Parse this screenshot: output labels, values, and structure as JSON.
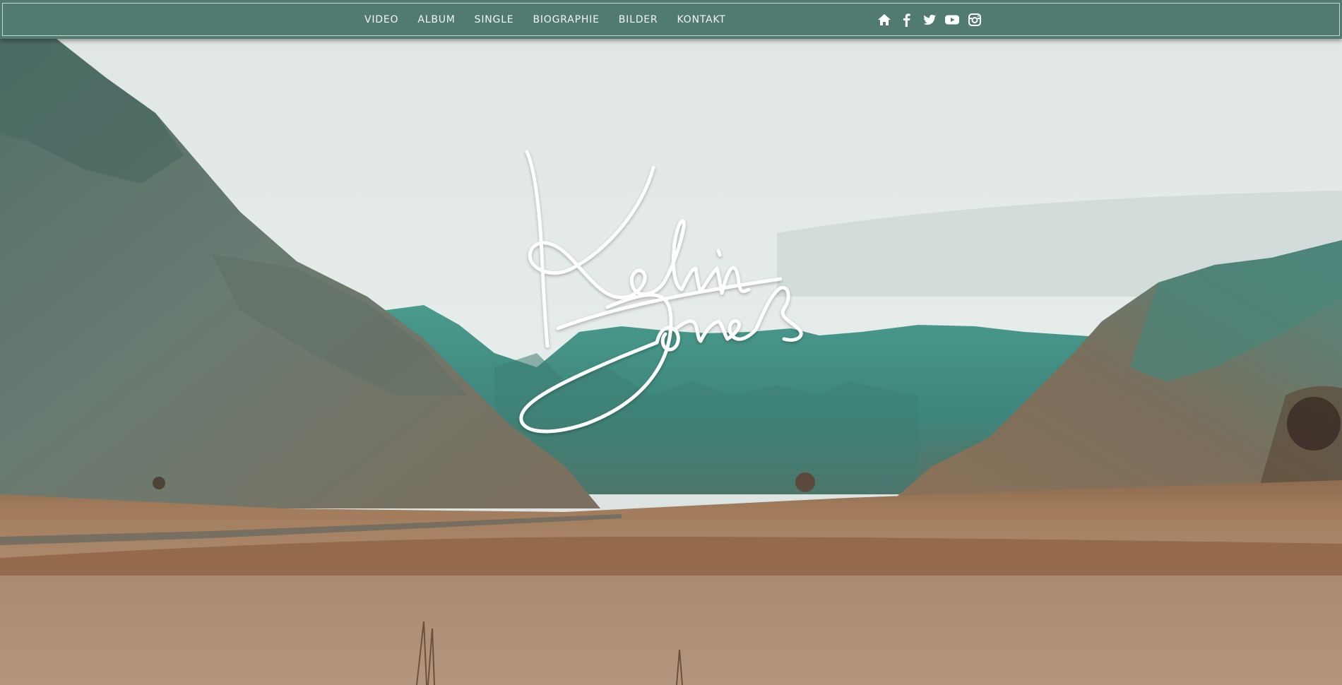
{
  "nav": {
    "links": [
      {
        "label": "VIDEO"
      },
      {
        "label": "ALBUM"
      },
      {
        "label": "SINGLE"
      },
      {
        "label": "BIOGRAPHIE"
      },
      {
        "label": "BILDER"
      },
      {
        "label": "KONTAKT"
      }
    ],
    "icons": [
      "home-icon",
      "facebook-icon",
      "twitter-icon",
      "youtube-icon",
      "instagram-icon"
    ],
    "background_color": "#517a70"
  },
  "hero": {
    "logo_signature": "Kelvin Jones",
    "description_colors": {
      "sky": "#e4ebe8",
      "mountains": "#3f8f86",
      "field": "#a88462"
    }
  }
}
